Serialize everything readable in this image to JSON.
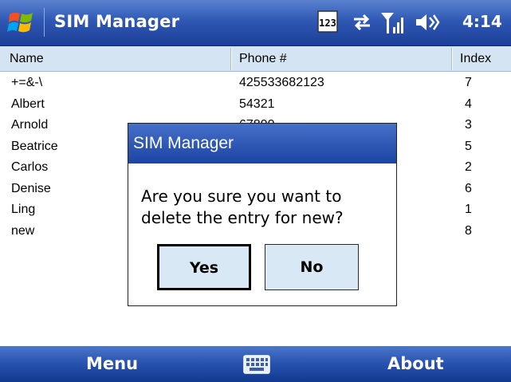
{
  "titlebar": {
    "title": "SIM Manager",
    "time": "4:14",
    "icons": [
      "windows-start-icon",
      "input-123-icon",
      "sync-arrows-icon",
      "signal-strength-icon",
      "speaker-icon"
    ]
  },
  "columns": [
    "Name",
    "Phone #",
    "Index"
  ],
  "entries": [
    {
      "name": "+=&-\\",
      "phone": "425533682123",
      "index": "7"
    },
    {
      "name": "Albert",
      "phone": "54321",
      "index": "4"
    },
    {
      "name": "Arnold",
      "phone": "67890",
      "index": "3"
    },
    {
      "name": "Beatrice",
      "phone": "",
      "index": "5"
    },
    {
      "name": "Carlos",
      "phone": "",
      "index": "2"
    },
    {
      "name": "Denise",
      "phone": "",
      "index": "6"
    },
    {
      "name": "Ling",
      "phone": "",
      "index": "1"
    },
    {
      "name": "new",
      "phone": "",
      "index": "8"
    }
  ],
  "dialog": {
    "title": "SIM Manager",
    "message": "Are you sure you want to\ndelete the entry for new?",
    "yes_label": "Yes",
    "no_label": "No"
  },
  "softkeys": {
    "left": "Menu",
    "right": "About",
    "center_icon": "keyboard-icon"
  },
  "colors": {
    "titlebar": "#2f58b4",
    "header_bg": "#d4e4f3",
    "button_bg": "#d8e8f4"
  }
}
